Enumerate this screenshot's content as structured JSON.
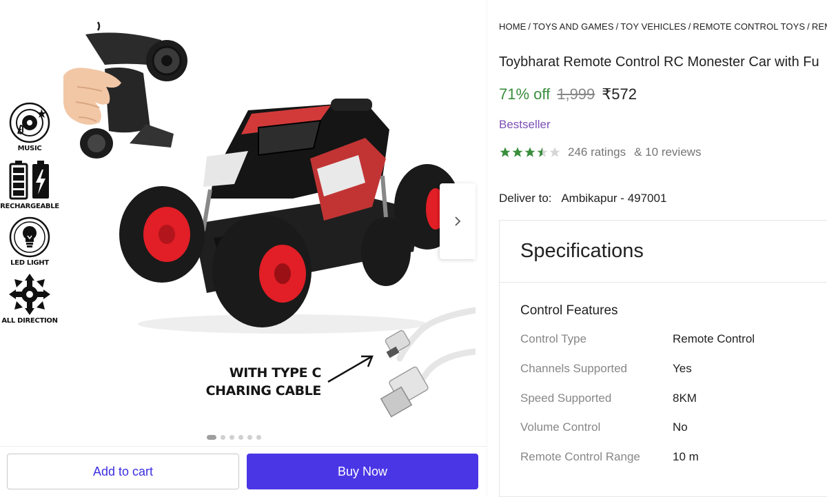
{
  "gallery": {
    "features": [
      {
        "label": "MUSIC",
        "icon": "music-disc-icon"
      },
      {
        "label": "RECHARGEABLE",
        "icon": "battery-icon"
      },
      {
        "label": "LED LIGHT",
        "icon": "led-bulb-icon"
      },
      {
        "label": "ALL DIRECTION",
        "icon": "all-direction-icon"
      }
    ],
    "caption_line1": "WITH TYPE C",
    "caption_line2": "CHARING CABLE",
    "slide_count": 6,
    "active_slide": 1
  },
  "actions": {
    "add_to_cart": "Add to cart",
    "buy_now": "Buy Now"
  },
  "product": {
    "breadcrumb": [
      "HOME",
      "TOYS AND GAMES",
      "TOY VEHICLES",
      "REMOTE CONTROL TOYS",
      "REMOTE CONTROL TOYS"
    ],
    "title": "Toybharat Remote Control RC Monester Car with Fu",
    "discount": "71% off",
    "mrp": "1,999",
    "price": "₹572",
    "badge": "Bestseller",
    "rating": 3.5,
    "ratings_count": "246 ratings",
    "reviews_count": "& 10 reviews",
    "deliver_label": "Deliver to:",
    "deliver_location": "Ambikapur - 497001"
  },
  "specifications": {
    "title": "Specifications",
    "section": "Control Features",
    "rows": [
      {
        "key": "Control Type",
        "value": "Remote Control"
      },
      {
        "key": "Channels Supported",
        "value": "Yes"
      },
      {
        "key": "Speed Supported",
        "value": "8KM"
      },
      {
        "key": "Volume Control",
        "value": "No"
      },
      {
        "key": "Remote Control Range",
        "value": "10 m"
      }
    ]
  },
  "colors": {
    "accent": "#4b36e6",
    "discount_green": "#388e3c",
    "star_green": "#388e3c",
    "badge_purple": "#7b4fb6"
  }
}
